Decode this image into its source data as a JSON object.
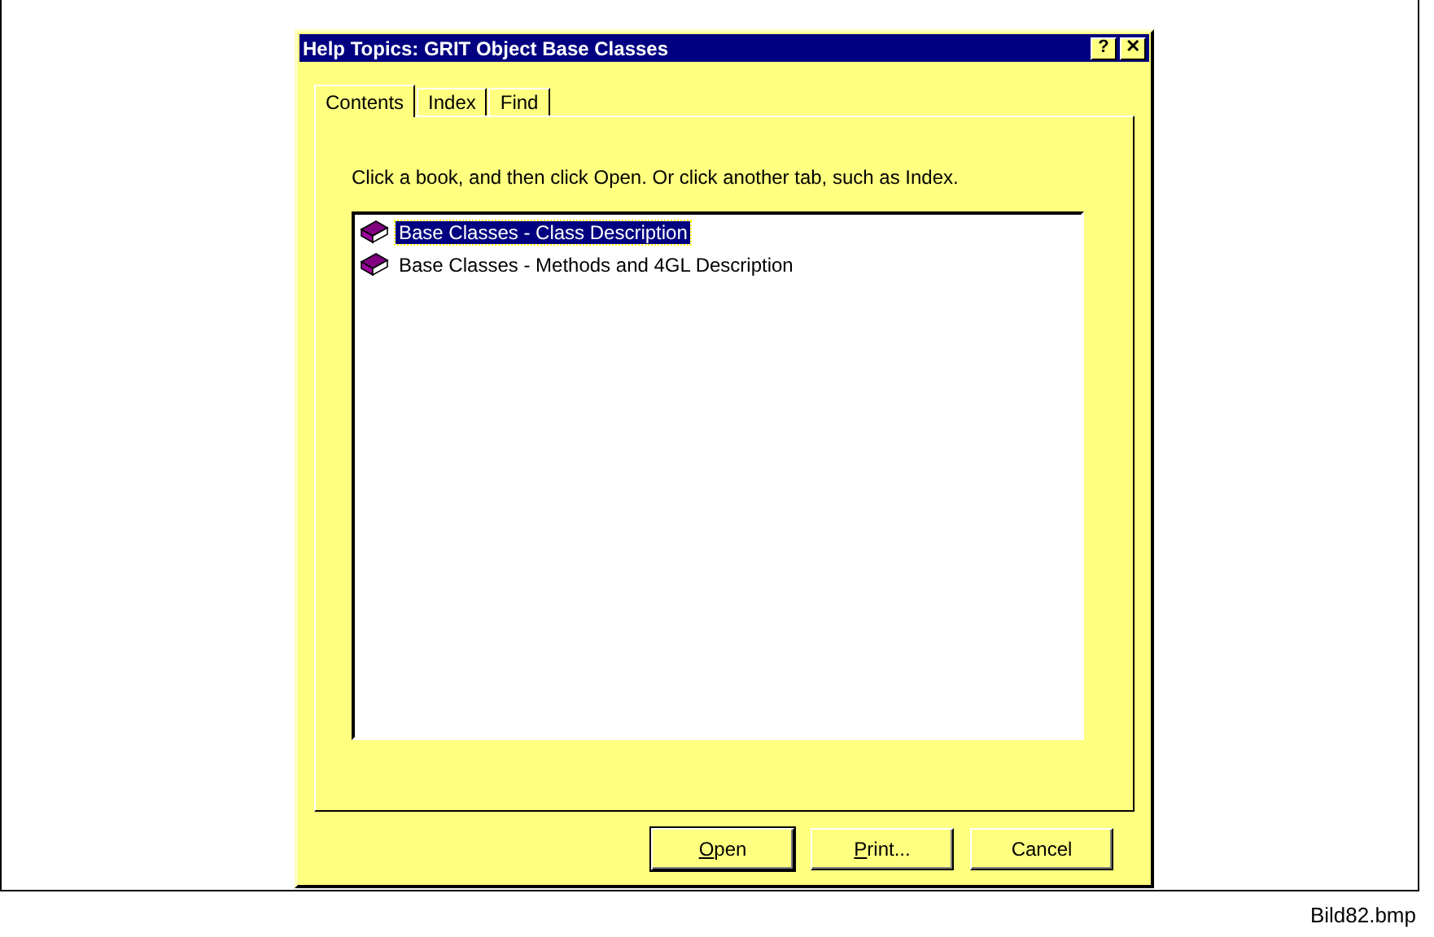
{
  "window": {
    "title": "Help Topics: GRIT Object Base Classes",
    "title_buttons": [
      {
        "label": "?"
      },
      {
        "label": "✕"
      }
    ]
  },
  "tabs": [
    {
      "label": "Contents",
      "selected": true
    },
    {
      "label": "Index",
      "selected": false
    },
    {
      "label": "Find",
      "selected": false
    }
  ],
  "instruction": "Click a book, and then click Open. Or click another tab, such as Index.",
  "books": [
    {
      "label": "Base Classes - Class Description",
      "selected": true
    },
    {
      "label": "Base Classes - Methods and 4GL Description",
      "selected": false
    }
  ],
  "buttons": [
    {
      "key": "O",
      "rest": "pen",
      "default": true
    },
    {
      "key": "P",
      "rest": "rint...",
      "default": false
    },
    {
      "rest": "Cancel",
      "default": false
    }
  ],
  "caption": "Bild82.bmp"
}
